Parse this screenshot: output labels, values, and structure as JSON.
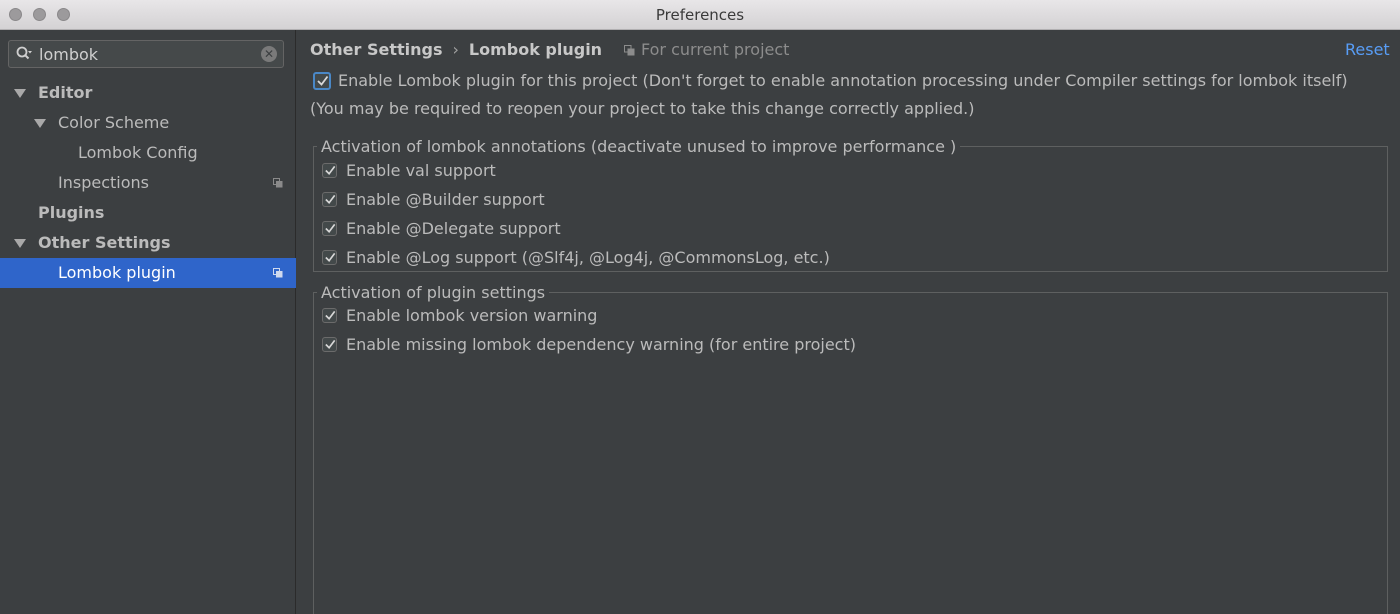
{
  "window": {
    "title": "Preferences"
  },
  "search": {
    "value": "lombok"
  },
  "sidebar": {
    "items": [
      {
        "label": "Editor"
      },
      {
        "label": "Color Scheme"
      },
      {
        "label": "Lombok Config"
      },
      {
        "label": "Inspections"
      },
      {
        "label": "Plugins"
      },
      {
        "label": "Other Settings"
      },
      {
        "label": "Lombok plugin"
      }
    ]
  },
  "header": {
    "breadcrumb": [
      "Other Settings",
      "Lombok plugin"
    ],
    "separator": "›",
    "scope": "For current project",
    "reset": "Reset"
  },
  "main": {
    "enable_plugin": {
      "label": "Enable Lombok plugin for this project (Don't forget to enable annotation processing under Compiler settings for lombok itself)",
      "checked": true
    },
    "note": "(You may be required to reopen your project to take this change correctly applied.)",
    "annotations_group": {
      "title": "Activation of lombok annotations (deactivate unused to improve performance )",
      "options": [
        {
          "label": "Enable val support",
          "checked": true
        },
        {
          "label": "Enable @Builder support",
          "checked": true
        },
        {
          "label": "Enable @Delegate support",
          "checked": true
        },
        {
          "label": "Enable @Log support (@Slf4j, @Log4j, @CommonsLog, etc.)",
          "checked": true
        }
      ]
    },
    "plugin_group": {
      "title": "Activation of plugin settings",
      "options": [
        {
          "label": "Enable lombok version warning",
          "checked": true
        },
        {
          "label": "Enable missing lombok dependency warning (for entire project)",
          "checked": true
        }
      ]
    }
  },
  "colors": {
    "background": "#3c3f41",
    "selection": "#2f65ca",
    "link": "#589df6"
  }
}
